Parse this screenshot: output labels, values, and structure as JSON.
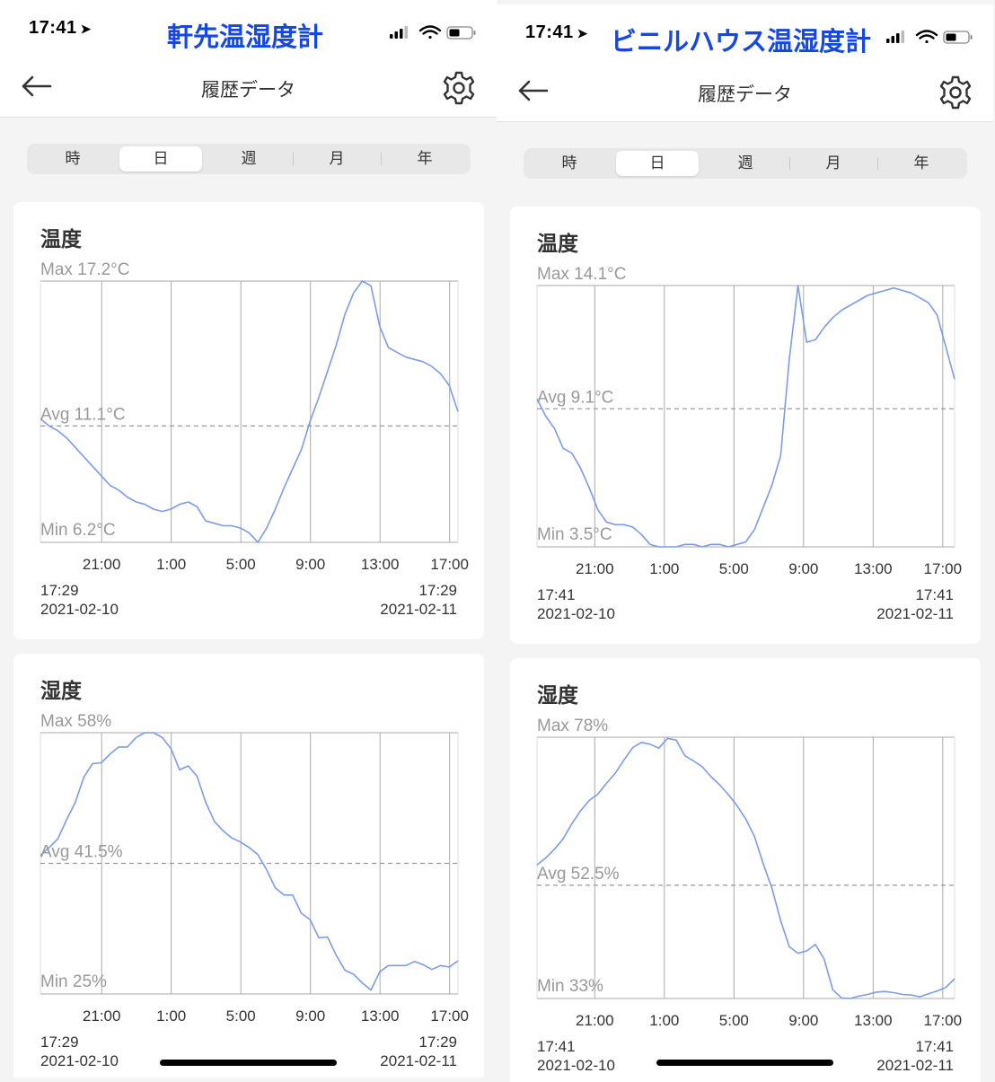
{
  "panels": [
    {
      "status_time": "17:41",
      "device_title": "軒先温湿度計",
      "nav_title": "履歴データ",
      "segments": [
        "時",
        "日",
        "週",
        "月",
        "年"
      ],
      "active_segment": 1,
      "temperature": {
        "title": "温度",
        "max_label": "Max 17.2°C",
        "avg_label": "Avg 11.1°C",
        "min_label": "Min 6.2°C",
        "start_time": "17:29",
        "start_date": "2021-02-10",
        "end_time": "17:29",
        "end_date": "2021-02-11"
      },
      "humidity": {
        "title": "湿度",
        "max_label": "Max 58%",
        "avg_label": "Avg 41.5%",
        "min_label": "Min 25%",
        "start_time": "17:29",
        "start_date": "2021-02-10",
        "end_time": "17:29",
        "end_date": "2021-02-11"
      }
    },
    {
      "status_time": "17:41",
      "device_title": "ビニルハウス温湿度計",
      "nav_title": "履歴データ",
      "segments": [
        "時",
        "日",
        "週",
        "月",
        "年"
      ],
      "active_segment": 1,
      "temperature": {
        "title": "温度",
        "max_label": "Max 14.1°C",
        "avg_label": "Avg 9.1°C",
        "min_label": "Min 3.5°C",
        "start_time": "17:41",
        "start_date": "2021-02-10",
        "end_time": "17:41",
        "end_date": "2021-02-11"
      },
      "humidity": {
        "title": "湿度",
        "max_label": "Max 78%",
        "avg_label": "Avg 52.5%",
        "min_label": "Min 33%",
        "start_time": "17:41",
        "start_date": "2021-02-10",
        "end_time": "17:41",
        "end_date": "2021-02-11"
      }
    }
  ],
  "colors": {
    "line": "#7b9ce6",
    "grid": "#aaaaaa",
    "avg": "#999999",
    "accent": "#1447e6"
  },
  "chart_data": [
    {
      "type": "line",
      "title": "温度",
      "x_start": "2021-02-10 17:29",
      "x_end": "2021-02-11 17:29",
      "x_ticks": [
        "21:00",
        "1:00",
        "5:00",
        "9:00",
        "13:00",
        "17:00"
      ],
      "x_tick_hours": [
        3.52,
        7.52,
        11.52,
        15.52,
        19.52,
        23.52
      ],
      "ylim": [
        6.2,
        17.2
      ],
      "max": 17.2,
      "avg": 11.1,
      "min": 6.2,
      "series": [
        {
          "x": [
            0,
            0.5,
            1,
            1.5,
            2,
            2.5,
            3,
            3.5,
            4,
            4.5,
            5,
            5.5,
            6,
            6.5,
            7,
            7.5,
            8,
            8.5,
            9,
            9.5,
            10,
            10.5,
            11,
            11.5,
            12,
            12.5,
            13,
            13.5,
            14,
            14.5,
            15,
            15.5,
            16,
            16.5,
            17,
            17.5,
            18,
            18.5,
            19,
            19.5,
            20,
            20.5,
            21,
            21.5,
            22,
            22.5,
            23,
            23.5,
            24
          ],
          "y": [
            11.4,
            11.1,
            10.9,
            10.6,
            10.2,
            9.8,
            9.4,
            9.0,
            8.6,
            8.4,
            8.1,
            7.9,
            7.8,
            7.6,
            7.5,
            7.6,
            7.8,
            7.9,
            7.7,
            7.1,
            7.0,
            6.9,
            6.9,
            6.8,
            6.6,
            6.2,
            6.8,
            7.6,
            8.5,
            9.3,
            10.1,
            11.3,
            12.3,
            13.4,
            14.5,
            15.8,
            16.7,
            17.2,
            17.0,
            15.3,
            14.4,
            14.2,
            14.0,
            13.9,
            13.8,
            13.6,
            13.3,
            12.8,
            11.7
          ]
        }
      ]
    },
    {
      "type": "line",
      "title": "湿度",
      "x_start": "2021-02-10 17:29",
      "x_end": "2021-02-11 17:29",
      "x_ticks": [
        "21:00",
        "1:00",
        "5:00",
        "9:00",
        "13:00",
        "17:00"
      ],
      "x_tick_hours": [
        3.52,
        7.52,
        11.52,
        15.52,
        19.52,
        23.52
      ],
      "ylim": [
        25,
        58
      ],
      "max": 58,
      "avg": 41.5,
      "min": 25,
      "series": [
        {
          "x": [
            0,
            0.5,
            1,
            1.5,
            2,
            2.5,
            3,
            3.5,
            4,
            4.5,
            5,
            5.5,
            6,
            6.5,
            7,
            7.5,
            8,
            8.5,
            9,
            9.5,
            10,
            10.5,
            11,
            11.5,
            12,
            12.5,
            13,
            13.5,
            14,
            14.5,
            15,
            15.5,
            16,
            16.5,
            17,
            17.5,
            18,
            18.5,
            19,
            19.5,
            20,
            20.5,
            21,
            21.5,
            22,
            22.5,
            23,
            23.5,
            24
          ],
          "y": [
            42.5,
            43.5,
            44.6,
            47,
            49.2,
            52.4,
            54.1,
            54.2,
            55.3,
            56.2,
            56.2,
            57.4,
            58,
            58,
            57.4,
            56,
            53.3,
            53.8,
            52.5,
            49.2,
            46.8,
            45.6,
            44.7,
            44.2,
            43.5,
            42.6,
            40.7,
            38.4,
            37.5,
            37.5,
            35.2,
            34.4,
            32.1,
            32.2,
            29.9,
            28,
            27.5,
            26.4,
            25.5,
            27.8,
            28.6,
            28.6,
            28.6,
            29.1,
            28.7,
            28.1,
            28.6,
            28.4,
            29.2
          ]
        }
      ]
    },
    {
      "type": "line",
      "title": "温度",
      "x_start": "2021-02-10 17:41",
      "x_end": "2021-02-11 17:41",
      "x_ticks": [
        "21:00",
        "1:00",
        "5:00",
        "9:00",
        "13:00",
        "17:00"
      ],
      "x_tick_hours": [
        3.32,
        7.32,
        11.32,
        15.32,
        19.32,
        23.32
      ],
      "ylim": [
        3.5,
        14.1
      ],
      "max": 14.1,
      "avg": 9.1,
      "min": 3.5,
      "series": [
        {
          "x": [
            0,
            0.5,
            1,
            1.5,
            2,
            2.5,
            3,
            3.5,
            4,
            4.5,
            5,
            5.5,
            6,
            6.5,
            7,
            7.5,
            8,
            8.5,
            9,
            9.5,
            10,
            10.5,
            11,
            11.5,
            12,
            12.5,
            13,
            13.5,
            14,
            14.5,
            15,
            15.5,
            16,
            16.5,
            17,
            17.5,
            18,
            18.5,
            19,
            19.5,
            20,
            20.5,
            21,
            21.5,
            22,
            22.5,
            23,
            23.5,
            24
          ],
          "y": [
            9.5,
            8.8,
            8.3,
            7.5,
            7.3,
            6.7,
            5.9,
            5.0,
            4.5,
            4.4,
            4.4,
            4.3,
            4.0,
            3.6,
            3.5,
            3.5,
            3.5,
            3.6,
            3.6,
            3.5,
            3.6,
            3.6,
            3.5,
            3.6,
            3.7,
            4.2,
            5.1,
            6.0,
            7.2,
            11.1,
            14.1,
            11.8,
            11.9,
            12.4,
            12.8,
            13.1,
            13.3,
            13.5,
            13.7,
            13.8,
            13.9,
            14.0,
            13.9,
            13.8,
            13.6,
            13.4,
            12.9,
            11.6,
            10.3
          ]
        }
      ]
    },
    {
      "type": "line",
      "title": "湿度",
      "x_start": "2021-02-10 17:41",
      "x_end": "2021-02-11 17:41",
      "x_ticks": [
        "21:00",
        "1:00",
        "5:00",
        "9:00",
        "13:00",
        "17:00"
      ],
      "x_tick_hours": [
        3.32,
        7.32,
        11.32,
        15.32,
        19.32,
        23.32
      ],
      "ylim": [
        33,
        78
      ],
      "max": 78,
      "avg": 52.5,
      "min": 33,
      "series": [
        {
          "x": [
            0,
            0.5,
            1,
            1.5,
            2,
            2.5,
            3,
            3.5,
            4,
            4.5,
            5,
            5.5,
            6,
            6.5,
            7,
            7.5,
            8,
            8.5,
            9,
            9.5,
            10,
            10.5,
            11,
            11.5,
            12,
            12.5,
            13,
            13.5,
            14,
            14.5,
            15,
            15.5,
            16,
            16.5,
            17,
            17.5,
            18,
            18.5,
            19,
            19.5,
            20,
            20.5,
            21,
            21.5,
            22,
            22.5,
            23,
            23.5,
            24
          ],
          "y": [
            56,
            57.2,
            58.7,
            60.5,
            63.1,
            65.3,
            67.1,
            68.2,
            70.1,
            71.8,
            74.1,
            76.2,
            77.1,
            76.8,
            76.1,
            77.8,
            77.5,
            74.8,
            73.9,
            72.9,
            71.2,
            69.8,
            68.1,
            66.2,
            63.9,
            60.9,
            56.2,
            52,
            46.4,
            41.9,
            40.8,
            41.2,
            42.3,
            39.8,
            34.5,
            33.1,
            33,
            33.4,
            33.7,
            34.1,
            34.2,
            34,
            33.7,
            33.6,
            33.3,
            33.8,
            34.3,
            34.9,
            36.4
          ]
        }
      ]
    }
  ]
}
